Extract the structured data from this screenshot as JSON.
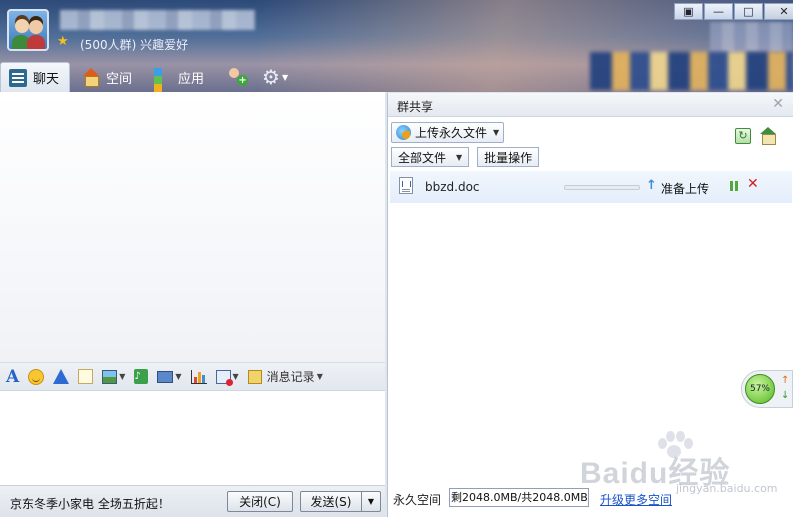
{
  "header": {
    "subtitle": "(500人群) 兴趣爱好",
    "window_buttons": {
      "menu": "▣",
      "minimize": "—",
      "maximize": "□",
      "close": "✕"
    }
  },
  "nav": {
    "tabs": [
      {
        "label": "聊天",
        "icon": "chat-icon",
        "active": true
      },
      {
        "label": "空间",
        "icon": "home-icon",
        "active": false
      },
      {
        "label": "应用",
        "icon": "apps-icon",
        "active": false
      }
    ]
  },
  "toolbar": {
    "history_label": "消息记录"
  },
  "footer": {
    "ad_text": "京东冬季小家电 全场五折起！",
    "close_label": "关闭(C)",
    "send_label": "发送(S)"
  },
  "panel": {
    "title": "群共享",
    "upload_label": "上传永久文件",
    "filter_select": "全部文件",
    "batch_label": "批量操作",
    "files": [
      {
        "name": "bbzd.doc",
        "status": "准备上传",
        "progress": 0
      }
    ],
    "storage_label": "永久空间",
    "storage_value": "剩2048.0MB/共2048.0MB",
    "upgrade_link": "升级更多空间"
  },
  "net_widget": {
    "percent": "57%"
  },
  "watermark": {
    "text": "Baidu经验",
    "url": "jingyan.baidu.com"
  },
  "colors": {
    "accent": "#1a53c9",
    "header": "#2d4a78",
    "cancel": "#cc2222"
  }
}
